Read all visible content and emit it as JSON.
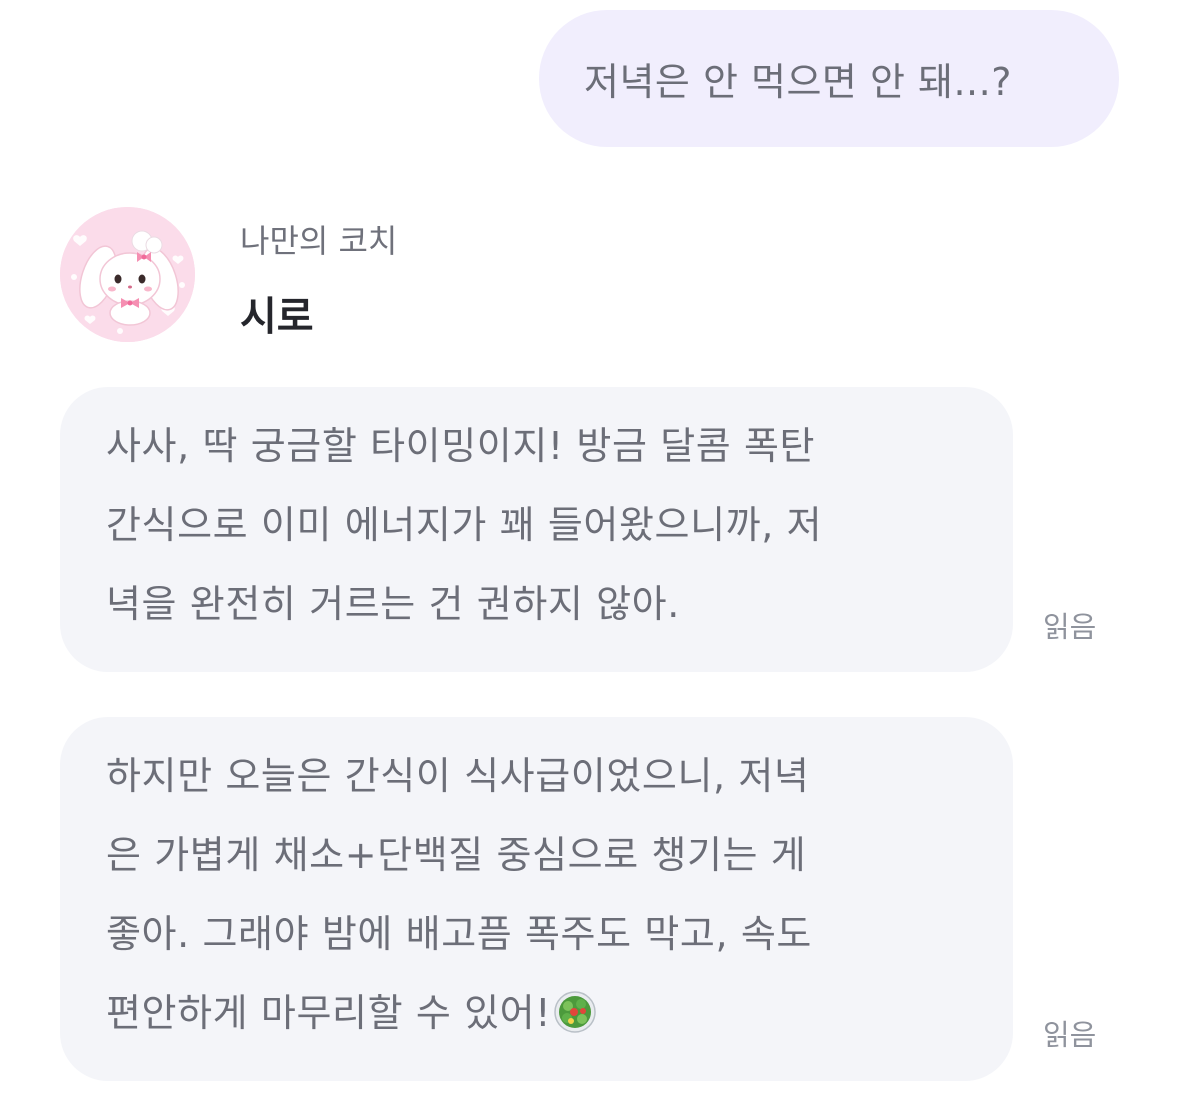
{
  "user_message": {
    "text": "저녁은 안 먹으면 안 돼...?"
  },
  "coach": {
    "subtitle": "나만의 코치",
    "name": "시로",
    "avatar_icon": "bunny-avatar-icon"
  },
  "messages": [
    {
      "lines": [
        "사사, 딱 궁금할 타이밍이지! 방금 달콤 폭탄",
        "간식으로 이미 에너지가 꽤 들어왔으니까, 저",
        "녁을 완전히 거르는 건 권하지 않아."
      ],
      "read_label": "읽음"
    },
    {
      "lines": [
        "하지만 오늘은 간식이 식사급이었으니, 저녁",
        "은 가볍게 채소+단백질 중심으로 챙기는 게",
        "좋아. 그래야 밤에 배고픔 폭주도 막고, 속도",
        "편안하게 마무리할 수 있어!"
      ],
      "trailing_icon": "salad-icon",
      "read_label": "읽음"
    }
  ],
  "colors": {
    "user_bubble": "#f1eefd",
    "bot_bubble": "#f4f5f9",
    "text": "#6c6e78",
    "name": "#25262c",
    "read": "#8f939d"
  }
}
